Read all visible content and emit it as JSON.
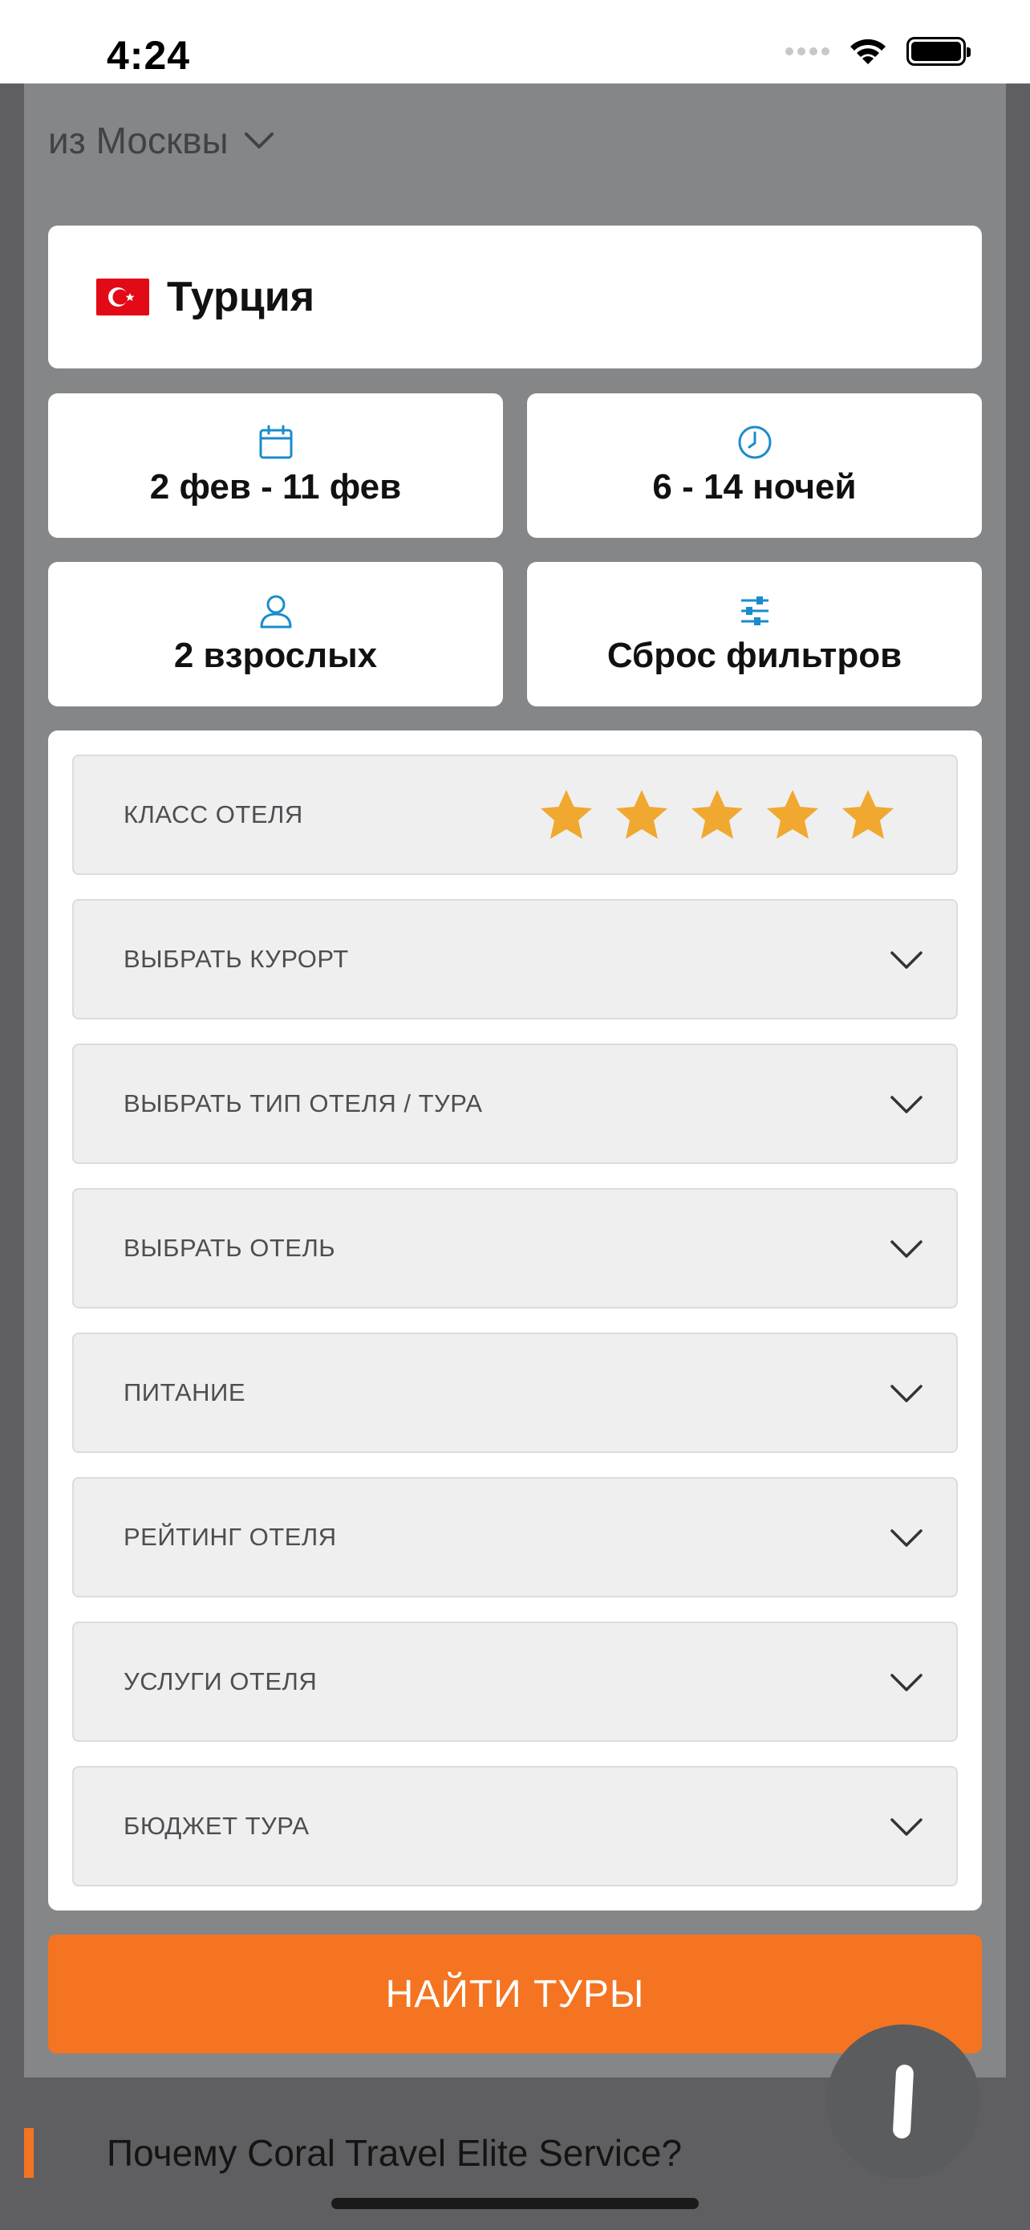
{
  "status_bar": {
    "time": "4:24"
  },
  "origin": {
    "label": "из Москвы"
  },
  "destination": {
    "country": "Турция",
    "flag_icon": "turkey-flag-icon",
    "flag_color": "#e30a17"
  },
  "tiles": {
    "dates": {
      "label": "2 фев - 11 фев",
      "icon": "calendar-icon"
    },
    "nights": {
      "label": "6 - 14 ночей",
      "icon": "clock-icon"
    },
    "adults": {
      "label": "2 взрослых",
      "icon": "user-icon"
    },
    "reset": {
      "label": "Сброс фильтров",
      "icon": "sliders-icon"
    }
  },
  "filters": {
    "hotel_class": {
      "label": "КЛАСС ОТЕЛЯ",
      "stars_selected": 5,
      "stars_total": 5,
      "star_color": "#f0a830"
    },
    "items": [
      {
        "label": "ВЫБРАТЬ КУРОРТ"
      },
      {
        "label": "ВЫБРАТЬ ТИП ОТЕЛЯ / ТУРА"
      },
      {
        "label": "ВЫБРАТЬ ОТЕЛЬ"
      },
      {
        "label": "ПИТАНИЕ"
      },
      {
        "label": "РЕЙТИНГ ОТЕЛЯ"
      },
      {
        "label": "УСЛУГИ ОТЕЛЯ"
      },
      {
        "label": "БЮДЖЕТ ТУРА"
      }
    ]
  },
  "search_button": {
    "label": "НАЙТИ ТУРЫ",
    "color": "#f47421"
  },
  "promo": {
    "text": "Почему Coral Travel Elite Service?"
  },
  "colors": {
    "accent": "#f47421",
    "icon_blue": "#1a8ccc",
    "panel": "#858688"
  }
}
